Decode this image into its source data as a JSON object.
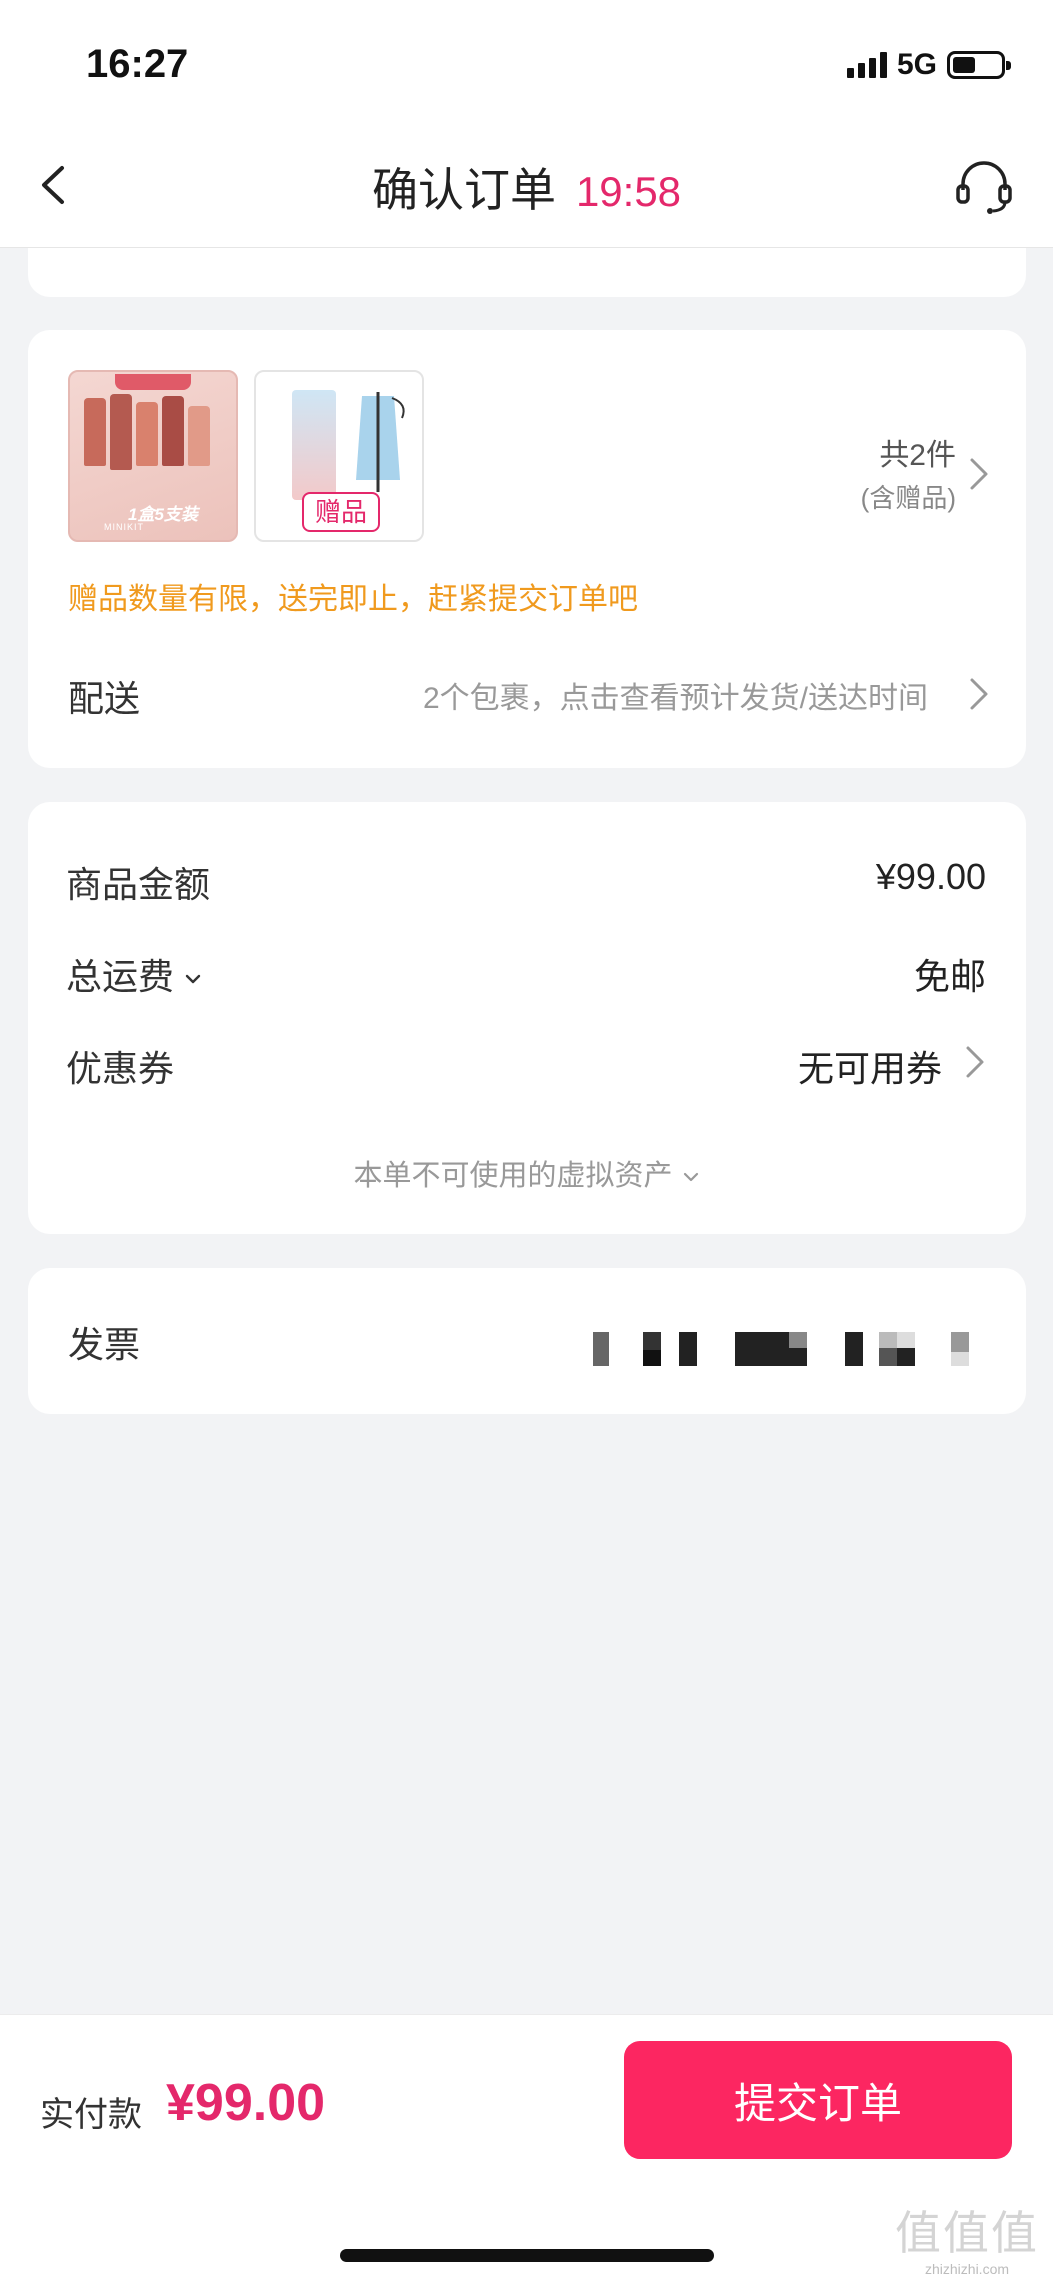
{
  "status_bar": {
    "time": "16:27",
    "network": "5G",
    "signal_icon": "signal-bars-icon",
    "battery_icon": "battery-icon"
  },
  "nav": {
    "title": "确认订单",
    "countdown": "19:58",
    "back_icon": "chevron-left-icon",
    "service_icon": "headset-icon",
    "countdown_color": "#e4286b"
  },
  "goods": {
    "product_pack_text": "1盒5支装",
    "product_pack_sub": "MINIKIT",
    "gift_tag": "赠品",
    "count": "共2件",
    "count_note": "(含赠品)",
    "gift_warning": "赠品数量有限，送完即止，赶紧提交订单吧",
    "delivery_label": "配送",
    "delivery_value": "2个包裹，点击查看预计发货/送达时间"
  },
  "price": {
    "subtotal_label": "商品金额",
    "subtotal_value": "¥99.00",
    "shipping_label": "总运费",
    "shipping_value": "免邮",
    "coupon_label": "优惠券",
    "coupon_value": "无可用券",
    "virtual_assets": "本单不可使用的虚拟资产"
  },
  "invoice": {
    "label": "发票"
  },
  "footer": {
    "pay_label": "实付款",
    "pay_amount": "¥99.00",
    "submit_label": "提交订单",
    "accent_color": "#fc2661"
  },
  "watermark": {
    "main": "值值值",
    "sub": "zhizhizhi.com"
  }
}
